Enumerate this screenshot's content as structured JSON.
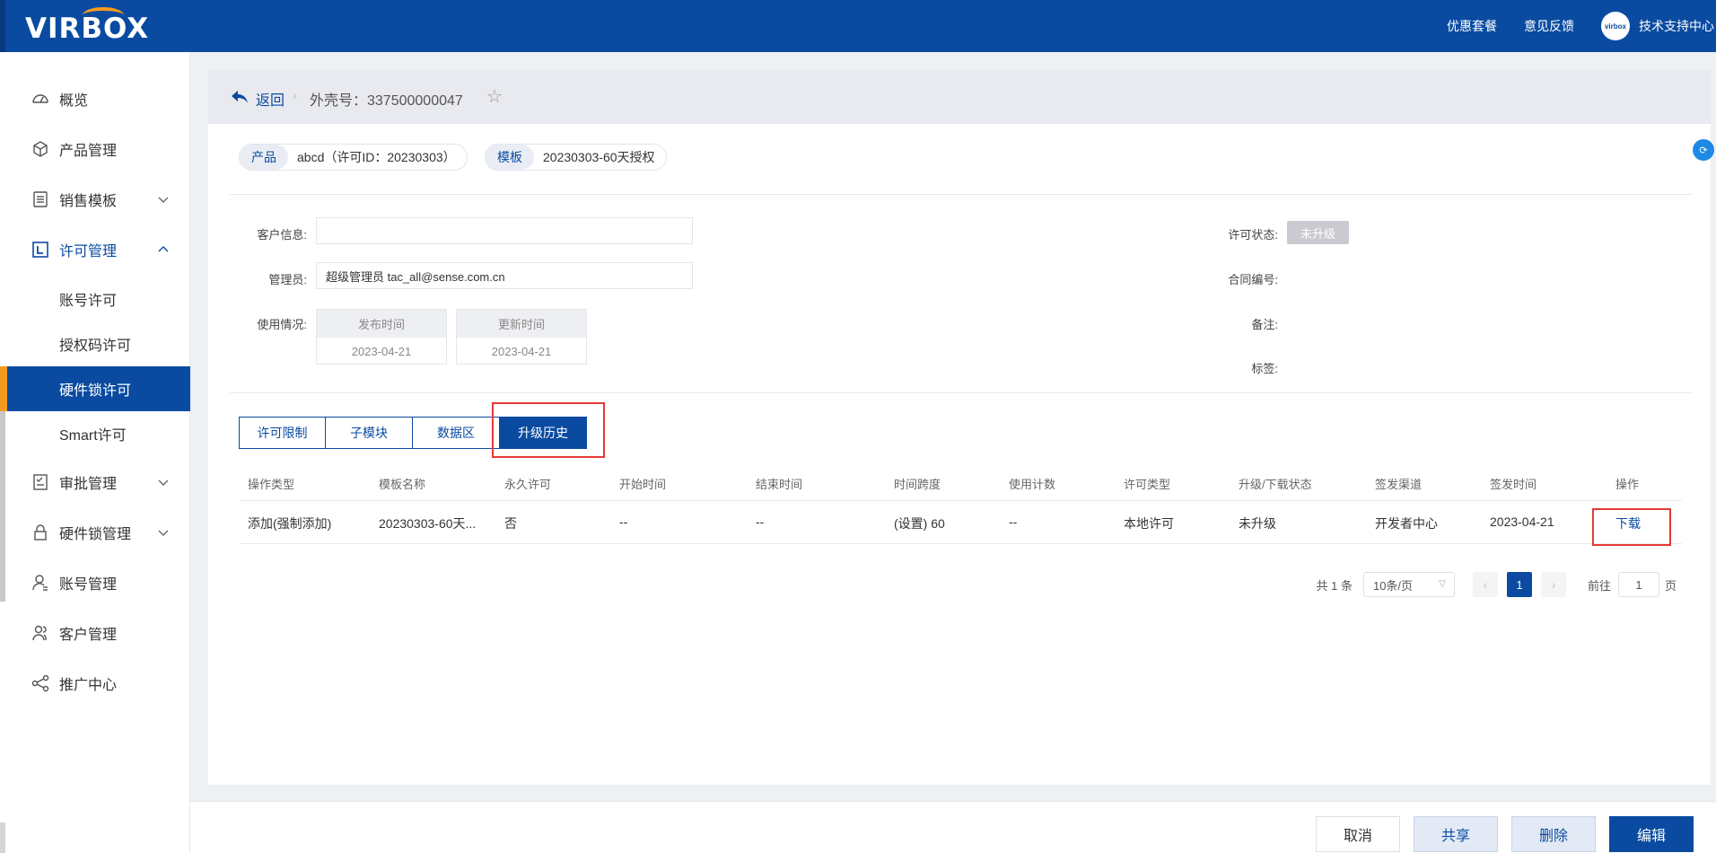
{
  "topbar": {
    "logo": "VIRBOX",
    "links": [
      "优惠套餐",
      "意见反馈"
    ],
    "avatar_text": "virbox",
    "support": "技术支持中心"
  },
  "sidebar": {
    "items": [
      {
        "label": "概览",
        "icon": "dashboard-icon"
      },
      {
        "label": "产品管理",
        "icon": "cube-icon"
      },
      {
        "label": "销售模板",
        "icon": "list-icon",
        "chevron": "down"
      },
      {
        "label": "许可管理",
        "icon": "license-icon",
        "chevron": "up"
      },
      {
        "label": "审批管理",
        "icon": "approval-icon",
        "chevron": "down"
      },
      {
        "label": "硬件锁管理",
        "icon": "lock-icon",
        "chevron": "down"
      },
      {
        "label": "账号管理",
        "icon": "user-icon"
      },
      {
        "label": "客户管理",
        "icon": "customers-icon"
      },
      {
        "label": "推广中心",
        "icon": "share-icon"
      }
    ],
    "license_sub": [
      "账号许可",
      "授权码许可",
      "硬件锁许可",
      "Smart许可"
    ]
  },
  "header": {
    "back": "返回",
    "shell": "外壳号：337500000047"
  },
  "pills": {
    "product_tag": "产品",
    "product_val": "abcd（许可ID：20230303）",
    "template_tag": "模板",
    "template_val": "20230303-60天授权"
  },
  "form": {
    "customer_label": "客户信息:",
    "customer_value": "",
    "admin_label": "管理员:",
    "admin_value": "超级管理员 tac_all@sense.com.cn",
    "usage_label": "使用情况:",
    "publish_head": "发布时间",
    "publish_val": "2023-04-21",
    "update_head": "更新时间",
    "update_val": "2023-04-21",
    "status_label": "许可状态:",
    "status_value": "未升级",
    "contract_label": "合同编号:",
    "remark_label": "备注:",
    "tag_label": "标签:"
  },
  "tabs": [
    "许可限制",
    "子模块",
    "数据区",
    "升级历史"
  ],
  "table": {
    "headers": [
      "操作类型",
      "模板名称",
      "永久许可",
      "开始时间",
      "结束时间",
      "时间跨度",
      "使用计数",
      "许可类型",
      "升级/下载状态",
      "签发渠道",
      "签发时间",
      "操作"
    ],
    "rows": [
      [
        "添加(强制添加)",
        "20230303-60天...",
        "否",
        "--",
        "--",
        "(设置) 60",
        "--",
        "本地许可",
        "未升级",
        "开发者中心",
        "2023-04-21",
        "下载"
      ]
    ]
  },
  "pager": {
    "total": "共 1 条",
    "size": "10条/页",
    "current": "1",
    "goto_prefix": "前往",
    "goto_value": "1",
    "goto_suffix": "页"
  },
  "footer": {
    "cancel": "取消",
    "share": "共享",
    "delete": "删除",
    "edit": "编辑"
  },
  "colors": {
    "brand": "#0a4ba1",
    "accent": "#f59a1e",
    "highlight": "#e53935"
  }
}
